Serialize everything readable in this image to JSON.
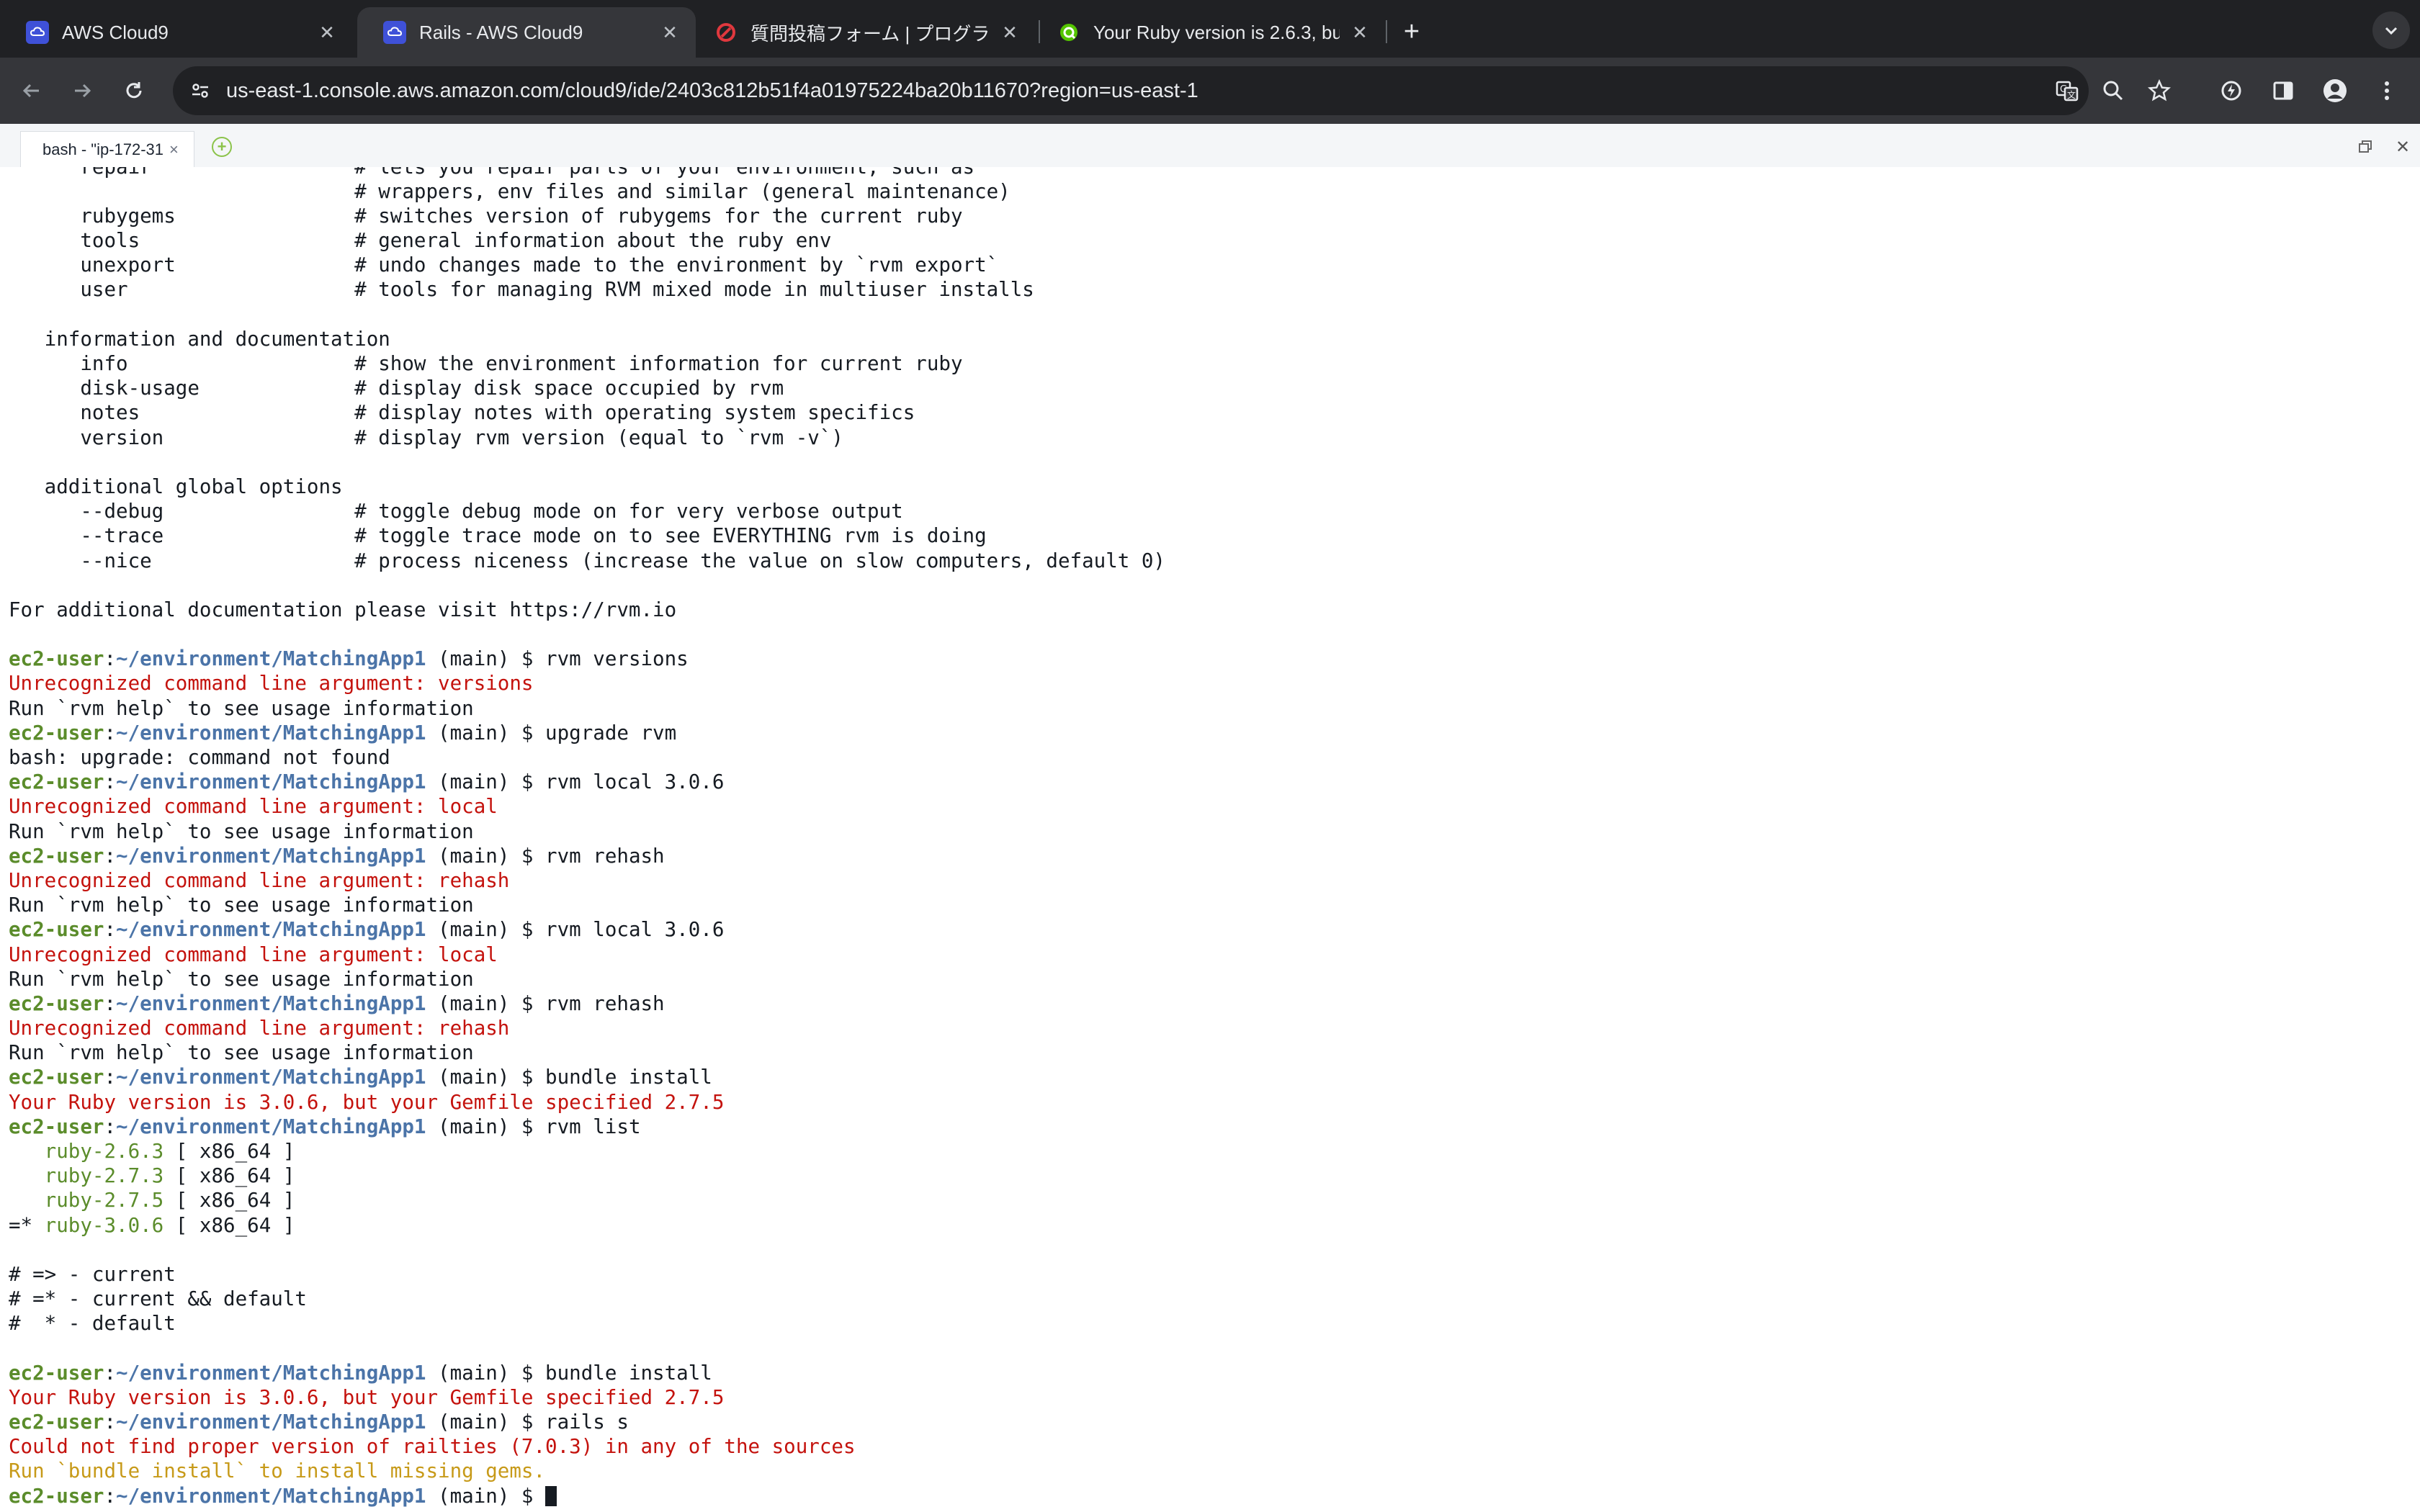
{
  "browser": {
    "tabs": [
      {
        "title": "AWS Cloud9",
        "favicon": "aws-cloud9-icon",
        "active": false
      },
      {
        "title": "Rails - AWS Cloud9",
        "favicon": "aws-cloud9-icon",
        "active": true
      },
      {
        "title": "質問投稿フォーム | プログラミン",
        "favicon": "teratail-icon",
        "active": false
      },
      {
        "title": "Your Ruby version is 2.6.3, bu",
        "favicon": "qiita-like-icon",
        "active": false
      }
    ],
    "new_tab_icon": "plus-icon",
    "url": "us-east-1.console.aws.amazon.com/cloud9/ide/2403c812b51f4a01975224ba20b11670?region=us-east-1",
    "colors": {
      "tabstrip": "#202124",
      "toolbar": "#35363a",
      "omnibox": "#202124"
    }
  },
  "ide": {
    "terminal_tab": {
      "label": "bash - \"ip-172-31"
    },
    "prompt": {
      "user": "ec2-user",
      "sep": ":",
      "path": "~/environment/MatchingApp1",
      "branch": " (main) $ "
    },
    "colors": {
      "error": "#c4120d",
      "warning": "#c79a19",
      "prompt_user": "#5b8c2b",
      "prompt_path": "#4b74a8",
      "ruby_version": "#5b8c2b"
    },
    "lines": [
      [
        {
          "t": "      repair                 # lets you repair parts of your environment, such as",
          "c": "out"
        }
      ],
      [
        {
          "t": "                             # wrappers, env files and similar (general maintenance)",
          "c": "out"
        }
      ],
      [
        {
          "t": "      rubygems               # switches version of rubygems for the current ruby",
          "c": "out"
        }
      ],
      [
        {
          "t": "      tools                  # general information about the ruby env",
          "c": "out"
        }
      ],
      [
        {
          "t": "      unexport               # undo changes made to the environment by `rvm export`",
          "c": "out"
        }
      ],
      [
        {
          "t": "      user                   # tools for managing RVM mixed mode in multiuser installs",
          "c": "out"
        }
      ],
      [
        {
          "t": "",
          "c": "out"
        }
      ],
      [
        {
          "t": "   information and documentation",
          "c": "out"
        }
      ],
      [
        {
          "t": "      info                   # show the environment information for current ruby",
          "c": "out"
        }
      ],
      [
        {
          "t": "      disk-usage             # display disk space occupied by rvm",
          "c": "out"
        }
      ],
      [
        {
          "t": "      notes                  # display notes with operating system specifics",
          "c": "out"
        }
      ],
      [
        {
          "t": "      version                # display rvm version (equal to `rvm -v`)",
          "c": "out"
        }
      ],
      [
        {
          "t": "",
          "c": "out"
        }
      ],
      [
        {
          "t": "   additional global options",
          "c": "out"
        }
      ],
      [
        {
          "t": "      --debug                # toggle debug mode on for very verbose output",
          "c": "out"
        }
      ],
      [
        {
          "t": "      --trace                # toggle trace mode on to see EVERYTHING rvm is doing",
          "c": "out"
        }
      ],
      [
        {
          "t": "      --nice                 # process niceness (increase the value on slow computers, default 0)",
          "c": "out"
        }
      ],
      [
        {
          "t": "",
          "c": "out"
        }
      ],
      [
        {
          "t": "For additional documentation please visit https://rvm.io",
          "c": "out"
        }
      ],
      [
        {
          "t": "",
          "c": "out"
        }
      ],
      [
        {
          "t": "ec2-user",
          "c": "user"
        },
        {
          "t": ":",
          "c": "out"
        },
        {
          "t": "~/environment/MatchingApp1",
          "c": "path"
        },
        {
          "t": " (main) $ rvm versions",
          "c": "out"
        }
      ],
      [
        {
          "t": "Unrecognized command line argument: versions",
          "c": "err"
        }
      ],
      [
        {
          "t": "Run `rvm help` to see usage information",
          "c": "out"
        }
      ],
      [
        {
          "t": "ec2-user",
          "c": "user"
        },
        {
          "t": ":",
          "c": "out"
        },
        {
          "t": "~/environment/MatchingApp1",
          "c": "path"
        },
        {
          "t": " (main) $ upgrade rvm",
          "c": "out"
        }
      ],
      [
        {
          "t": "bash: upgrade: command not found",
          "c": "out"
        }
      ],
      [
        {
          "t": "ec2-user",
          "c": "user"
        },
        {
          "t": ":",
          "c": "out"
        },
        {
          "t": "~/environment/MatchingApp1",
          "c": "path"
        },
        {
          "t": " (main) $ rvm local 3.0.6",
          "c": "out"
        }
      ],
      [
        {
          "t": "Unrecognized command line argument: local",
          "c": "err"
        }
      ],
      [
        {
          "t": "Run `rvm help` to see usage information",
          "c": "out"
        }
      ],
      [
        {
          "t": "ec2-user",
          "c": "user"
        },
        {
          "t": ":",
          "c": "out"
        },
        {
          "t": "~/environment/MatchingApp1",
          "c": "path"
        },
        {
          "t": " (main) $ rvm rehash",
          "c": "out"
        }
      ],
      [
        {
          "t": "Unrecognized command line argument: rehash",
          "c": "err"
        }
      ],
      [
        {
          "t": "Run `rvm help` to see usage information",
          "c": "out"
        }
      ],
      [
        {
          "t": "ec2-user",
          "c": "user"
        },
        {
          "t": ":",
          "c": "out"
        },
        {
          "t": "~/environment/MatchingApp1",
          "c": "path"
        },
        {
          "t": " (main) $ rvm local 3.0.6",
          "c": "out"
        }
      ],
      [
        {
          "t": "Unrecognized command line argument: local",
          "c": "err"
        }
      ],
      [
        {
          "t": "Run `rvm help` to see usage information",
          "c": "out"
        }
      ],
      [
        {
          "t": "ec2-user",
          "c": "user"
        },
        {
          "t": ":",
          "c": "out"
        },
        {
          "t": "~/environment/MatchingApp1",
          "c": "path"
        },
        {
          "t": " (main) $ rvm rehash",
          "c": "out"
        }
      ],
      [
        {
          "t": "Unrecognized command line argument: rehash",
          "c": "err"
        }
      ],
      [
        {
          "t": "Run `rvm help` to see usage information",
          "c": "out"
        }
      ],
      [
        {
          "t": "ec2-user",
          "c": "user"
        },
        {
          "t": ":",
          "c": "out"
        },
        {
          "t": "~/environment/MatchingApp1",
          "c": "path"
        },
        {
          "t": " (main) $ bundle install",
          "c": "out"
        }
      ],
      [
        {
          "t": "Your Ruby version is 3.0.6, but your Gemfile specified 2.7.5",
          "c": "err"
        }
      ],
      [
        {
          "t": "ec2-user",
          "c": "user"
        },
        {
          "t": ":",
          "c": "out"
        },
        {
          "t": "~/environment/MatchingApp1",
          "c": "path"
        },
        {
          "t": " (main) $ rvm list",
          "c": "out"
        }
      ],
      [
        {
          "t": "   ",
          "c": "out"
        },
        {
          "t": "ruby-2.6.3",
          "c": "ruby"
        },
        {
          "t": " [ x86_64 ]",
          "c": "out"
        }
      ],
      [
        {
          "t": "   ",
          "c": "out"
        },
        {
          "t": "ruby-2.7.3",
          "c": "ruby"
        },
        {
          "t": " [ x86_64 ]",
          "c": "out"
        }
      ],
      [
        {
          "t": "   ",
          "c": "out"
        },
        {
          "t": "ruby-2.7.5",
          "c": "ruby"
        },
        {
          "t": " [ x86_64 ]",
          "c": "out"
        }
      ],
      [
        {
          "t": "=* ",
          "c": "out"
        },
        {
          "t": "ruby-3.0.6",
          "c": "ruby"
        },
        {
          "t": " [ x86_64 ]",
          "c": "out"
        }
      ],
      [
        {
          "t": "",
          "c": "out"
        }
      ],
      [
        {
          "t": "# => - current",
          "c": "out"
        }
      ],
      [
        {
          "t": "# =* - current && default",
          "c": "out"
        }
      ],
      [
        {
          "t": "#  * - default",
          "c": "out"
        }
      ],
      [
        {
          "t": "",
          "c": "out"
        }
      ],
      [
        {
          "t": "ec2-user",
          "c": "user"
        },
        {
          "t": ":",
          "c": "out"
        },
        {
          "t": "~/environment/MatchingApp1",
          "c": "path"
        },
        {
          "t": " (main) $ bundle install",
          "c": "out"
        }
      ],
      [
        {
          "t": "Your Ruby version is 3.0.6, but your Gemfile specified 2.7.5",
          "c": "err"
        }
      ],
      [
        {
          "t": "ec2-user",
          "c": "user"
        },
        {
          "t": ":",
          "c": "out"
        },
        {
          "t": "~/environment/MatchingApp1",
          "c": "path"
        },
        {
          "t": " (main) $ rails s",
          "c": "out"
        }
      ],
      [
        {
          "t": "Could not find proper version of railties (7.0.3) in any of the sources",
          "c": "err"
        }
      ],
      [
        {
          "t": "Run `bundle install` to install missing gems.",
          "c": "warn"
        }
      ],
      [
        {
          "t": "ec2-user",
          "c": "user"
        },
        {
          "t": ":",
          "c": "out"
        },
        {
          "t": "~/environment/MatchingApp1",
          "c": "path"
        },
        {
          "t": " (main) $ ",
          "c": "out"
        },
        {
          "t": "",
          "c": "cursor"
        }
      ]
    ]
  }
}
